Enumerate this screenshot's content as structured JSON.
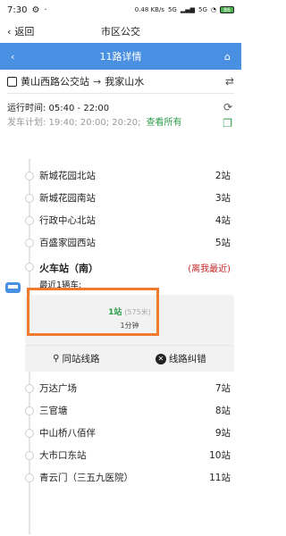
{
  "status": {
    "time": "7:30",
    "net": "0.48 KB/s",
    "sig1": "5G",
    "sig2": "5G",
    "battery": "86"
  },
  "appbar": {
    "back_label": "返回",
    "title": "市区公交"
  },
  "route": {
    "title": "11路详情"
  },
  "direction": {
    "from": "黄山西路公交站",
    "arrow": "→",
    "to": "我家山水"
  },
  "times": {
    "run_label": "运行时间: 05:40 - 22:00",
    "plan_label": "发车计划: 19:40; 20:00; 20:20;",
    "more_label": "查看所有"
  },
  "stations_top": [
    {
      "name": "新城花园北站",
      "count": "2站"
    },
    {
      "name": "新城花园南站",
      "count": "3站"
    },
    {
      "name": "行政中心北站",
      "count": "4站"
    },
    {
      "name": "百盛家园西站",
      "count": "5站"
    }
  ],
  "current": {
    "name": "火车站（南）",
    "near_label": "(离我最近)",
    "recent_label": "最近1辆车:"
  },
  "eta": {
    "main": "1站",
    "dist": "(575米)",
    "min": "1分钟"
  },
  "actions": {
    "same_station": "同站线路",
    "correct": "线路纠错"
  },
  "stations_bottom": [
    {
      "name": "万达广场",
      "count": "7站"
    },
    {
      "name": "三官塘",
      "count": "8站"
    },
    {
      "name": "中山桥八佰伴",
      "count": "9站"
    },
    {
      "name": "大市口东站",
      "count": "10站"
    },
    {
      "name": "青云门（三五九医院）",
      "count": "11站"
    }
  ],
  "colors": {
    "accent": "#4a90e2",
    "highlight": "#f07b2f",
    "green": "#2e9d4b",
    "red": "#c62828"
  }
}
